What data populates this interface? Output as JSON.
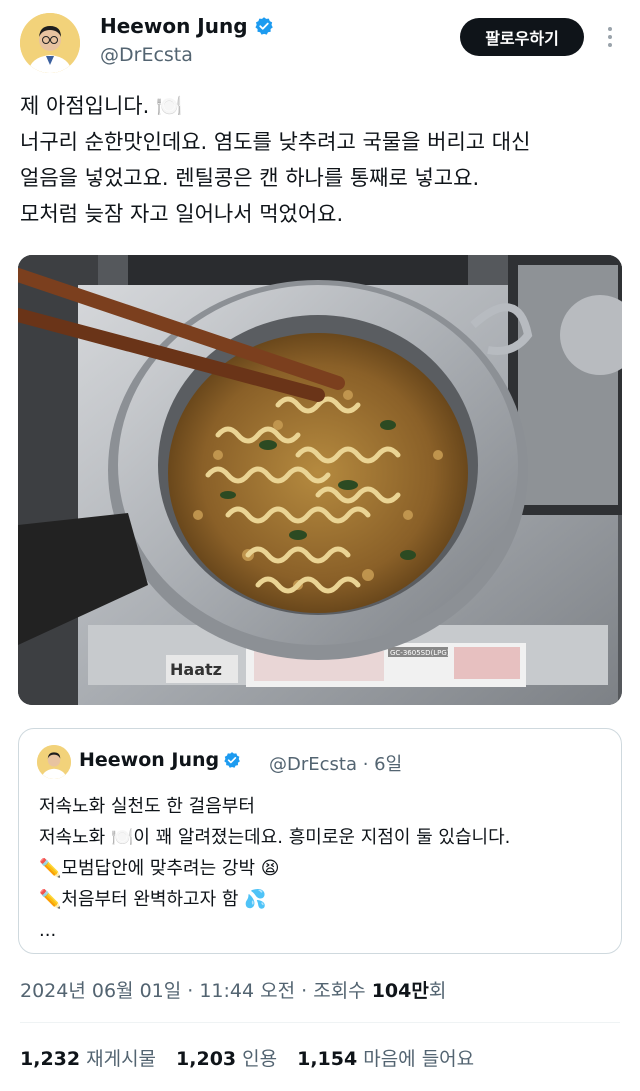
{
  "author": {
    "name": "Heewon Jung",
    "handle": "@DrEcsta",
    "verified_color": "#1d9bf0"
  },
  "follow_button": "팔로우하기",
  "tweet": {
    "lines": [
      "제 아점입니다. 🍽️",
      "너구리 순한맛인데요. 염도를 낮추려고 국물을 버리고 대신",
      "얼음을 넣었고요. 렌틸콩은 캔 하나를 통째로 넣고요.",
      "모처럼 늦잠 자고 일어나서 먹었어요."
    ]
  },
  "photo": {
    "stove_label": "Haatz",
    "model_label": "GC-3605SD(LPG)"
  },
  "quote": {
    "name": "Heewon Jung",
    "meta": "@DrEcsta · 6일",
    "lines": [
      "저속노화 실천도 한 걸음부터",
      "저속노화 🍽️이 꽤 알려졌는데요. 흥미로운 지점이 둘 있습니다.",
      "✏️모범답안에 맞추려는 강박 😫",
      "✏️처음부터 완벽하고자 함 💦",
      "..."
    ]
  },
  "meta": {
    "datetime": "2024년 06월 01일 · 11:44 오전 · 조회수 ",
    "views": "104만",
    "views_suffix": "회"
  },
  "stats": {
    "retweets_count": "1,232",
    "retweets_label": "재게시물",
    "quotes_count": "1,203",
    "quotes_label": "인용",
    "likes_count": "1,154",
    "likes_label": "마음에 들어요"
  }
}
